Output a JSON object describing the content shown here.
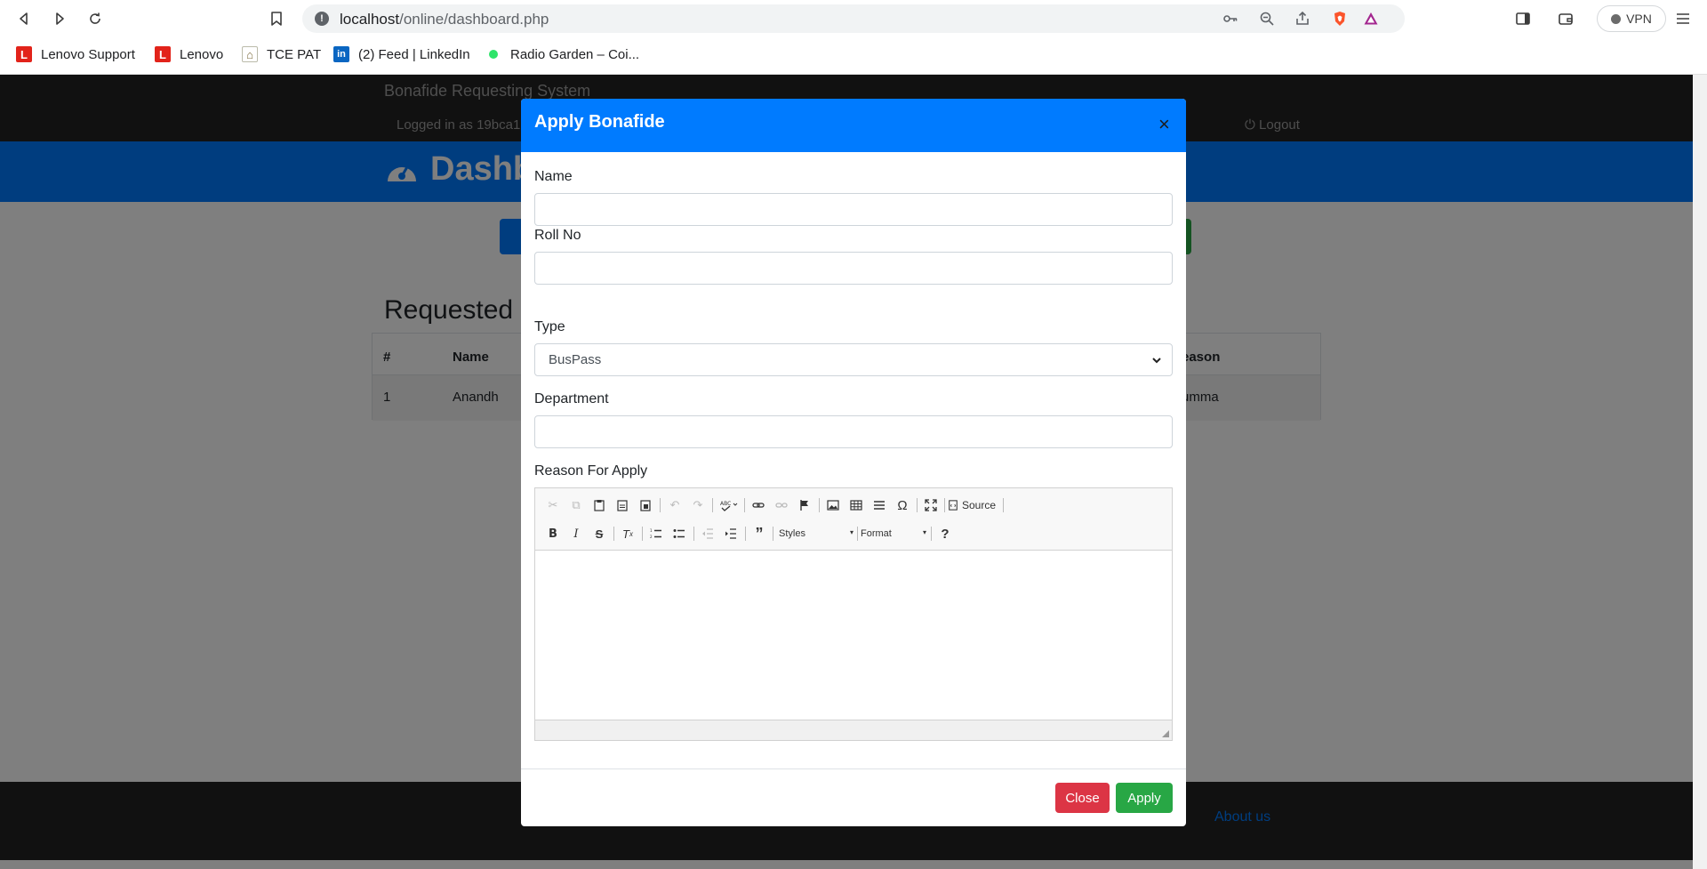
{
  "browser": {
    "url_host": "localhost",
    "url_path": "/online/dashboard.php",
    "vpn_label": "VPN",
    "bookmarks": [
      {
        "label": "Lenovo Support",
        "icon": "lenovo-icon"
      },
      {
        "label": "Lenovo",
        "icon": "lenovo-icon"
      },
      {
        "label": "TCE PAT",
        "icon": "tce-icon"
      },
      {
        "label": "(2) Feed | LinkedIn",
        "icon": "linkedin-icon"
      },
      {
        "label": "Radio Garden – Coi...",
        "icon": "radio-garden-icon"
      }
    ]
  },
  "page": {
    "brand": "Bonafide Requesting System",
    "logged_in": "Logged in as 19bca1",
    "logout": "Logout",
    "dashboard_title": "Dashb",
    "requested_title": "Requested",
    "table_headers": [
      "#",
      "Name",
      "eason"
    ],
    "table_rows": [
      [
        "1",
        "Anandh",
        "umma"
      ]
    ],
    "footer_link": "About us"
  },
  "modal": {
    "title": "Apply Bonafide",
    "close_glyph": "×",
    "fields": {
      "name_label": "Name",
      "name_value": "",
      "rollno_label": "Roll No",
      "rollno_value": "",
      "type_label": "Type",
      "type_selected": "BusPass",
      "department_label": "Department",
      "department_value": "",
      "reason_label": "Reason For Apply"
    },
    "editor": {
      "source_label": "Source",
      "styles_label": "Styles",
      "format_label": "Format",
      "help_label": "?"
    },
    "buttons": {
      "close": "Close",
      "apply": "Apply"
    }
  },
  "colors": {
    "primary": "#007bff",
    "danger": "#dc3545",
    "success": "#28a745",
    "dark": "#222222"
  }
}
